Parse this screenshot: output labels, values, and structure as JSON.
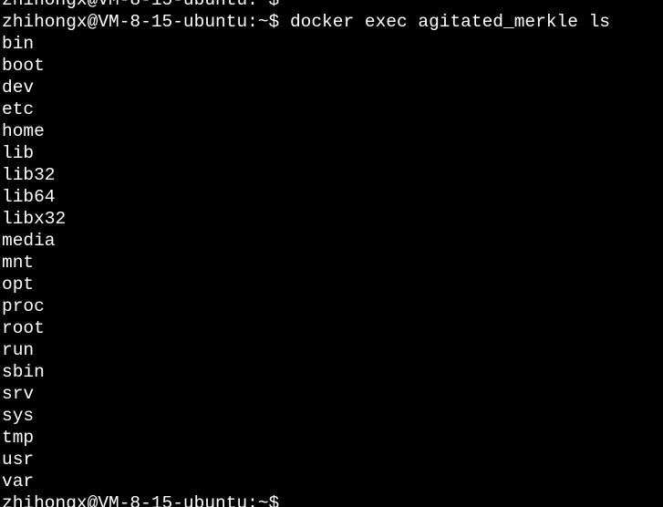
{
  "terminal": {
    "partial_top_line": "zhihongx@VM-8-15-ubuntu:~$",
    "prompt": "zhihongx@VM-8-15-ubuntu:~$",
    "command": " docker exec agitated_merkle ls",
    "output": [
      "bin",
      "boot",
      "dev",
      "etc",
      "home",
      "lib",
      "lib32",
      "lib64",
      "libx32",
      "media",
      "mnt",
      "opt",
      "proc",
      "root",
      "run",
      "sbin",
      "srv",
      "sys",
      "tmp",
      "usr",
      "var"
    ],
    "final_prompt": "zhihongx@VM-8-15-ubuntu:~$",
    "colors": {
      "background": "#000000",
      "foreground": "#ffffff"
    }
  }
}
